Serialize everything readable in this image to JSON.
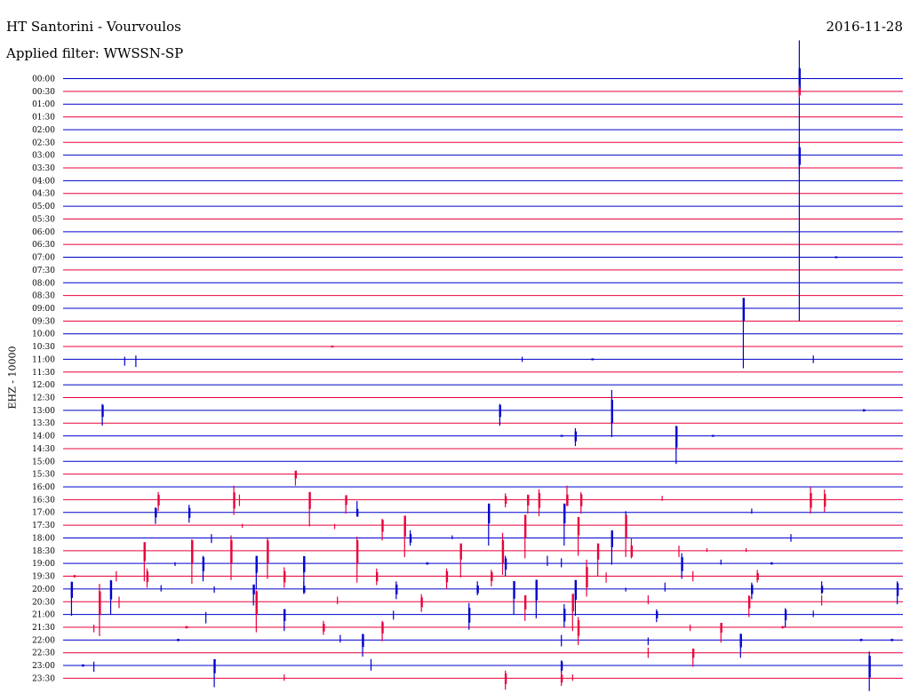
{
  "header": {
    "station": "HT Santorini - Vourvoulos",
    "filter": "Applied filter: WWSSN-SP",
    "date": "2016-11-28",
    "channel": "EHZ - 10000"
  },
  "colors": {
    "even_row": "#0000cc",
    "odd_row": "#e8003a",
    "background": "#ffffff"
  },
  "chart_data": {
    "type": "line",
    "title": "HT Santorini - Vourvoulos",
    "subtitle": "Applied filter: WWSSN-SP",
    "ylabel": "EHZ - 10000",
    "xlabel": "",
    "grid": false,
    "x_unit": "minutes within 30-minute row",
    "x_range": [
      0,
      30
    ],
    "row_labels": [
      "00:00",
      "00:30",
      "01:00",
      "01:30",
      "02:00",
      "02:30",
      "03:00",
      "03:30",
      "04:00",
      "04:30",
      "05:00",
      "05:30",
      "06:00",
      "06:30",
      "07:00",
      "07:30",
      "08:00",
      "08:30",
      "09:00",
      "09:30",
      "10:00",
      "10:30",
      "11:00",
      "11:30",
      "12:00",
      "12:30",
      "13:00",
      "13:30",
      "14:00",
      "14:30",
      "15:00",
      "15:30",
      "16:00",
      "16:30",
      "17:00",
      "17:30",
      "18:00",
      "18:30",
      "19:00",
      "19:30",
      "20:00",
      "20:30",
      "21:00",
      "21:30",
      "22:00",
      "22:30",
      "23:00",
      "23:30"
    ],
    "events": [
      {
        "row": 0,
        "t": 26.3,
        "up": 3.0,
        "down": 19.0
      },
      {
        "row": 1,
        "t": 26.3,
        "up": 0.5,
        "down": 0.5
      },
      {
        "row": 6,
        "t": 26.3,
        "up": 1.0,
        "down": 1.5
      },
      {
        "row": 14,
        "t": 27.6,
        "up": 0.05,
        "down": 0.05
      },
      {
        "row": 18,
        "t": 24.3,
        "up": 0.2,
        "down": 4.7
      },
      {
        "row": 21,
        "t": 9.6,
        "up": 0.05,
        "down": 0.05
      },
      {
        "row": 22,
        "t": 2.2,
        "up": 0.2,
        "down": 0.5
      },
      {
        "row": 22,
        "t": 2.6,
        "up": 0.3,
        "down": 0.6
      },
      {
        "row": 22,
        "t": 16.4,
        "up": 0.2,
        "down": 0.2
      },
      {
        "row": 22,
        "t": 18.9,
        "up": 0.05,
        "down": 0.05
      },
      {
        "row": 22,
        "t": 26.8,
        "up": 0.3,
        "down": 0.3
      },
      {
        "row": 26,
        "t": 1.4,
        "up": 0.5,
        "down": 1.2
      },
      {
        "row": 26,
        "t": 15.6,
        "up": 0.5,
        "down": 1.2
      },
      {
        "row": 26,
        "t": 19.6,
        "up": 1.6,
        "down": 2.1
      },
      {
        "row": 26,
        "t": 28.6,
        "up": 0.1,
        "down": 0.1
      },
      {
        "row": 28,
        "t": 17.8,
        "up": 0.05,
        "down": 0.05
      },
      {
        "row": 28,
        "t": 18.3,
        "up": 0.6,
        "down": 0.8
      },
      {
        "row": 28,
        "t": 21.9,
        "up": 0.8,
        "down": 2.2
      },
      {
        "row": 28,
        "t": 23.2,
        "up": 0.05,
        "down": 0.05
      },
      {
        "row": 31,
        "t": 8.3,
        "up": 0.2,
        "down": 0.9
      },
      {
        "row": 33,
        "t": 3.4,
        "up": 0.6,
        "down": 0.9
      },
      {
        "row": 33,
        "t": 6.1,
        "up": 1.1,
        "down": 1.2
      },
      {
        "row": 33,
        "t": 6.3,
        "up": 0.4,
        "down": 0.5
      },
      {
        "row": 33,
        "t": 8.8,
        "up": 0.3,
        "down": 2.1
      },
      {
        "row": 33,
        "t": 10.1,
        "up": 0.3,
        "down": 1.1
      },
      {
        "row": 33,
        "t": 15.8,
        "up": 0.5,
        "down": 0.6
      },
      {
        "row": 33,
        "t": 16.6,
        "up": 0.4,
        "down": 1.1
      },
      {
        "row": 33,
        "t": 17.0,
        "up": 0.8,
        "down": 1.3
      },
      {
        "row": 33,
        "t": 18.0,
        "up": 1.1,
        "down": 0.5
      },
      {
        "row": 33,
        "t": 18.5,
        "up": 0.6,
        "down": 1.1
      },
      {
        "row": 33,
        "t": 21.4,
        "up": 0.3,
        "down": 0.1
      },
      {
        "row": 33,
        "t": 26.7,
        "up": 1.0,
        "down": 1.1
      },
      {
        "row": 33,
        "t": 27.2,
        "up": 0.8,
        "down": 1.0
      },
      {
        "row": 34,
        "t": 3.3,
        "up": 0.4,
        "down": 0.9
      },
      {
        "row": 34,
        "t": 4.5,
        "up": 0.6,
        "down": 0.8
      },
      {
        "row": 34,
        "t": 10.5,
        "up": 0.9,
        "down": 0.2
      },
      {
        "row": 34,
        "t": 15.2,
        "up": 0.2,
        "down": 2.6
      },
      {
        "row": 34,
        "t": 17.9,
        "up": 0.2,
        "down": 2.6
      },
      {
        "row": 34,
        "t": 20.1,
        "up": 0.1,
        "down": 0.3
      },
      {
        "row": 34,
        "t": 24.6,
        "up": 0.3,
        "down": 0.1
      },
      {
        "row": 35,
        "t": 6.4,
        "up": 0.1,
        "down": 0.2
      },
      {
        "row": 35,
        "t": 9.7,
        "up": 0.1,
        "down": 0.3
      },
      {
        "row": 35,
        "t": 11.4,
        "up": 0.5,
        "down": 1.2
      },
      {
        "row": 35,
        "t": 12.2,
        "up": 0.5,
        "down": 2.5
      },
      {
        "row": 35,
        "t": 16.5,
        "up": 0.8,
        "down": 2.6
      },
      {
        "row": 35,
        "t": 18.4,
        "up": 0.2,
        "down": 2.4
      },
      {
        "row": 35,
        "t": 20.1,
        "up": 0.8,
        "down": 2.5
      },
      {
        "row": 36,
        "t": 5.3,
        "up": 0.3,
        "down": 0.4
      },
      {
        "row": 36,
        "t": 12.4,
        "up": 0.6,
        "down": 0.6
      },
      {
        "row": 36,
        "t": 13.9,
        "up": 0.2,
        "down": 0.1
      },
      {
        "row": 36,
        "t": 19.6,
        "up": 0.3,
        "down": 2.1
      },
      {
        "row": 36,
        "t": 26.0,
        "up": 0.3,
        "down": 0.3
      },
      {
        "row": 37,
        "t": 2.9,
        "up": 0.3,
        "down": 2.4
      },
      {
        "row": 37,
        "t": 4.6,
        "up": 0.9,
        "down": 2.6
      },
      {
        "row": 37,
        "t": 6.0,
        "up": 1.2,
        "down": 2.3
      },
      {
        "row": 37,
        "t": 7.3,
        "up": 1.0,
        "down": 2.2
      },
      {
        "row": 37,
        "t": 10.5,
        "up": 1.1,
        "down": 2.5
      },
      {
        "row": 37,
        "t": 14.2,
        "up": 0.2,
        "down": 2.1
      },
      {
        "row": 37,
        "t": 15.7,
        "up": 1.4,
        "down": 1.9
      },
      {
        "row": 37,
        "t": 19.1,
        "up": 0.3,
        "down": 2.0
      },
      {
        "row": 37,
        "t": 20.3,
        "up": 1.0,
        "down": 0.6
      },
      {
        "row": 37,
        "t": 22.0,
        "up": 0.4,
        "down": 0.5
      },
      {
        "row": 37,
        "t": 23.0,
        "up": 0.2,
        "down": 0.1
      },
      {
        "row": 37,
        "t": 24.4,
        "up": 0.2,
        "down": 0.1
      },
      {
        "row": 38,
        "t": 4.0,
        "up": 0.1,
        "down": 0.2
      },
      {
        "row": 38,
        "t": 5.0,
        "up": 0.6,
        "down": 1.4
      },
      {
        "row": 38,
        "t": 6.9,
        "up": 0.4,
        "down": 2.0
      },
      {
        "row": 38,
        "t": 8.6,
        "up": 0.2,
        "down": 2.1
      },
      {
        "row": 38,
        "t": 13.0,
        "up": 0.1,
        "down": 0.1
      },
      {
        "row": 38,
        "t": 15.8,
        "up": 0.6,
        "down": 1.0
      },
      {
        "row": 38,
        "t": 17.3,
        "up": 0.6,
        "down": 0.2
      },
      {
        "row": 38,
        "t": 17.8,
        "up": 0.4,
        "down": 0.3
      },
      {
        "row": 38,
        "t": 22.1,
        "up": 0.8,
        "down": 1.2
      },
      {
        "row": 38,
        "t": 23.5,
        "up": 0.3,
        "down": 0.1
      },
      {
        "row": 38,
        "t": 25.3,
        "up": 0.1,
        "down": 0.1
      },
      {
        "row": 39,
        "t": 0.4,
        "up": 0.1,
        "down": 0.1
      },
      {
        "row": 39,
        "t": 1.9,
        "up": 0.4,
        "down": 0.4
      },
      {
        "row": 39,
        "t": 3.0,
        "up": 0.6,
        "down": 0.9
      },
      {
        "row": 39,
        "t": 7.9,
        "up": 0.7,
        "down": 0.9
      },
      {
        "row": 39,
        "t": 11.2,
        "up": 0.6,
        "down": 0.7
      },
      {
        "row": 39,
        "t": 13.7,
        "up": 0.6,
        "down": 1.0
      },
      {
        "row": 39,
        "t": 15.3,
        "up": 0.5,
        "down": 0.8
      },
      {
        "row": 39,
        "t": 18.7,
        "up": 1.3,
        "down": 1.6
      },
      {
        "row": 39,
        "t": 19.4,
        "up": 0.3,
        "down": 0.5
      },
      {
        "row": 39,
        "t": 22.5,
        "up": 0.4,
        "down": 0.4
      },
      {
        "row": 39,
        "t": 24.8,
        "up": 0.5,
        "down": 0.5
      },
      {
        "row": 40,
        "t": 0.3,
        "up": 0.2,
        "down": 2.1
      },
      {
        "row": 40,
        "t": 1.7,
        "up": 0.7,
        "down": 2.0
      },
      {
        "row": 40,
        "t": 3.5,
        "up": 0.3,
        "down": 0.2
      },
      {
        "row": 40,
        "t": 5.4,
        "up": 0.2,
        "down": 0.3
      },
      {
        "row": 40,
        "t": 6.8,
        "up": 0.1,
        "down": 1.3
      },
      {
        "row": 40,
        "t": 8.6,
        "up": 0.6,
        "down": 0.4
      },
      {
        "row": 40,
        "t": 11.9,
        "up": 0.6,
        "down": 0.8
      },
      {
        "row": 40,
        "t": 14.8,
        "up": 0.6,
        "down": 0.5
      },
      {
        "row": 40,
        "t": 16.1,
        "up": 0.5,
        "down": 2.0
      },
      {
        "row": 40,
        "t": 16.9,
        "up": 0.6,
        "down": 2.3
      },
      {
        "row": 40,
        "t": 18.3,
        "up": 0.7,
        "down": 2.1
      },
      {
        "row": 40,
        "t": 20.1,
        "up": 0.1,
        "down": 0.2
      },
      {
        "row": 40,
        "t": 21.5,
        "up": 0.5,
        "down": 0.2
      },
      {
        "row": 40,
        "t": 24.6,
        "up": 0.5,
        "down": 0.8
      },
      {
        "row": 40,
        "t": 27.1,
        "up": 0.6,
        "down": 0.4
      },
      {
        "row": 40,
        "t": 29.8,
        "up": 0.6,
        "down": 1.2
      },
      {
        "row": 41,
        "t": 1.3,
        "up": 1.4,
        "down": 2.7
      },
      {
        "row": 41,
        "t": 2.0,
        "up": 0.4,
        "down": 0.5
      },
      {
        "row": 41,
        "t": 6.9,
        "up": 0.9,
        "down": 2.4
      },
      {
        "row": 41,
        "t": 9.8,
        "up": 0.4,
        "down": 0.2
      },
      {
        "row": 41,
        "t": 12.8,
        "up": 0.6,
        "down": 0.8
      },
      {
        "row": 41,
        "t": 16.5,
        "up": 0.5,
        "down": 1.5
      },
      {
        "row": 41,
        "t": 18.2,
        "up": 0.2,
        "down": 2.3
      },
      {
        "row": 41,
        "t": 20.9,
        "up": 0.5,
        "down": 0.2
      },
      {
        "row": 41,
        "t": 24.5,
        "up": 0.5,
        "down": 1.2
      },
      {
        "row": 41,
        "t": 27.1,
        "up": 0.5,
        "down": 0.3
      },
      {
        "row": 42,
        "t": 5.1,
        "up": 0.2,
        "down": 0.7
      },
      {
        "row": 42,
        "t": 7.9,
        "up": 0.4,
        "down": 1.3
      },
      {
        "row": 42,
        "t": 11.8,
        "up": 0.3,
        "down": 0.4
      },
      {
        "row": 42,
        "t": 14.5,
        "up": 0.9,
        "down": 1.2
      },
      {
        "row": 42,
        "t": 17.9,
        "up": 0.8,
        "down": 1.0
      },
      {
        "row": 42,
        "t": 21.2,
        "up": 0.4,
        "down": 0.6
      },
      {
        "row": 42,
        "t": 25.8,
        "up": 0.5,
        "down": 1.0
      },
      {
        "row": 42,
        "t": 26.8,
        "up": 0.3,
        "down": 0.2
      },
      {
        "row": 43,
        "t": 1.1,
        "up": 0.2,
        "down": 0.4
      },
      {
        "row": 43,
        "t": 4.4,
        "up": 0.1,
        "down": 0.1
      },
      {
        "row": 43,
        "t": 9.3,
        "up": 0.5,
        "down": 0.6
      },
      {
        "row": 43,
        "t": 11.4,
        "up": 0.5,
        "down": 1.1
      },
      {
        "row": 43,
        "t": 18.4,
        "up": 0.8,
        "down": 1.4
      },
      {
        "row": 43,
        "t": 22.4,
        "up": 0.2,
        "down": 0.3
      },
      {
        "row": 43,
        "t": 23.5,
        "up": 0.2,
        "down": 1.2
      },
      {
        "row": 43,
        "t": 25.7,
        "up": 0.1,
        "down": 0.1
      },
      {
        "row": 44,
        "t": 4.1,
        "up": 0.1,
        "down": 0.1
      },
      {
        "row": 44,
        "t": 9.9,
        "up": 0.4,
        "down": 0.2
      },
      {
        "row": 44,
        "t": 10.7,
        "up": 0.5,
        "down": 1.3
      },
      {
        "row": 44,
        "t": 17.8,
        "up": 0.4,
        "down": 0.5
      },
      {
        "row": 44,
        "t": 20.9,
        "up": 0.2,
        "down": 0.4
      },
      {
        "row": 44,
        "t": 24.2,
        "up": 0.5,
        "down": 1.4
      },
      {
        "row": 44,
        "t": 28.5,
        "up": 0.1,
        "down": 0.1
      },
      {
        "row": 44,
        "t": 29.6,
        "up": 0.1,
        "down": 0.1
      },
      {
        "row": 45,
        "t": 20.9,
        "up": 0.4,
        "down": 0.4
      },
      {
        "row": 45,
        "t": 22.5,
        "up": 0.2,
        "down": 1.1
      },
      {
        "row": 46,
        "t": 0.7,
        "up": 0.1,
        "down": 0.1
      },
      {
        "row": 46,
        "t": 1.1,
        "up": 0.3,
        "down": 0.5
      },
      {
        "row": 46,
        "t": 5.4,
        "up": 0.3,
        "down": 1.7
      },
      {
        "row": 46,
        "t": 11.0,
        "up": 0.5,
        "down": 0.4
      },
      {
        "row": 46,
        "t": 17.8,
        "up": 0.4,
        "down": 0.9
      },
      {
        "row": 46,
        "t": 28.8,
        "up": 1.1,
        "down": 2.0
      },
      {
        "row": 47,
        "t": 7.9,
        "up": 0.3,
        "down": 0.2
      },
      {
        "row": 47,
        "t": 15.8,
        "up": 0.6,
        "down": 0.9
      },
      {
        "row": 47,
        "t": 17.8,
        "up": 0.5,
        "down": 0.6
      },
      {
        "row": 47,
        "t": 18.2,
        "up": 0.3,
        "down": 0.2
      }
    ]
  }
}
